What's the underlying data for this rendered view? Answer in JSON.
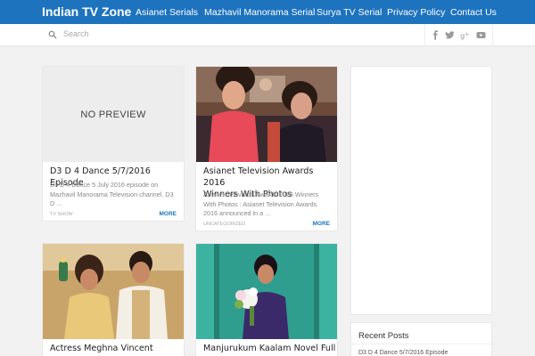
{
  "site": {
    "title": "Indian TV Zone"
  },
  "nav": {
    "items": [
      "Asianet Serials",
      "Mazhavil Manorama Serial",
      "Surya TV Serial",
      "Privacy Policy",
      "Contact Us"
    ]
  },
  "search": {
    "placeholder": "Search"
  },
  "social": [
    "facebook-icon",
    "twitter-icon",
    "google-plus-icon",
    "youtube-icon"
  ],
  "posts": [
    {
      "title": "D3 D 4 Dance 5/7/2016 Episode",
      "excerpt_lines": [
        "D3 D 4 Dance 5 July 2016 episode on",
        "Mazhavil Manorama Television channel. D3",
        "D ..."
      ],
      "category": "TV SHOW",
      "more": "MORE",
      "thumb_text": "NO PREVIEW"
    },
    {
      "title_lines": [
        "Asianet Television Awards 2016",
        "Winners With Photos"
      ],
      "excerpt_lines": [
        "Asianet Television Awards 2016 Winners",
        "With Photos : Asianet Television Awards",
        "2016 announced in a ..."
      ],
      "category": "UNCATEGORIZED",
      "more": "MORE"
    },
    {
      "title": "Actress Meghna Vincent"
    },
    {
      "title": "Manjurukum Kaalam Novel Full"
    }
  ],
  "sidebar": {
    "recent_heading": "Recent Posts",
    "recent_items": [
      "D3 D 4 Dance 5/7/2016 Episode"
    ]
  },
  "colors": {
    "brand": "#1e73be",
    "background": "#f2f2f2",
    "card": "#ffffff"
  }
}
